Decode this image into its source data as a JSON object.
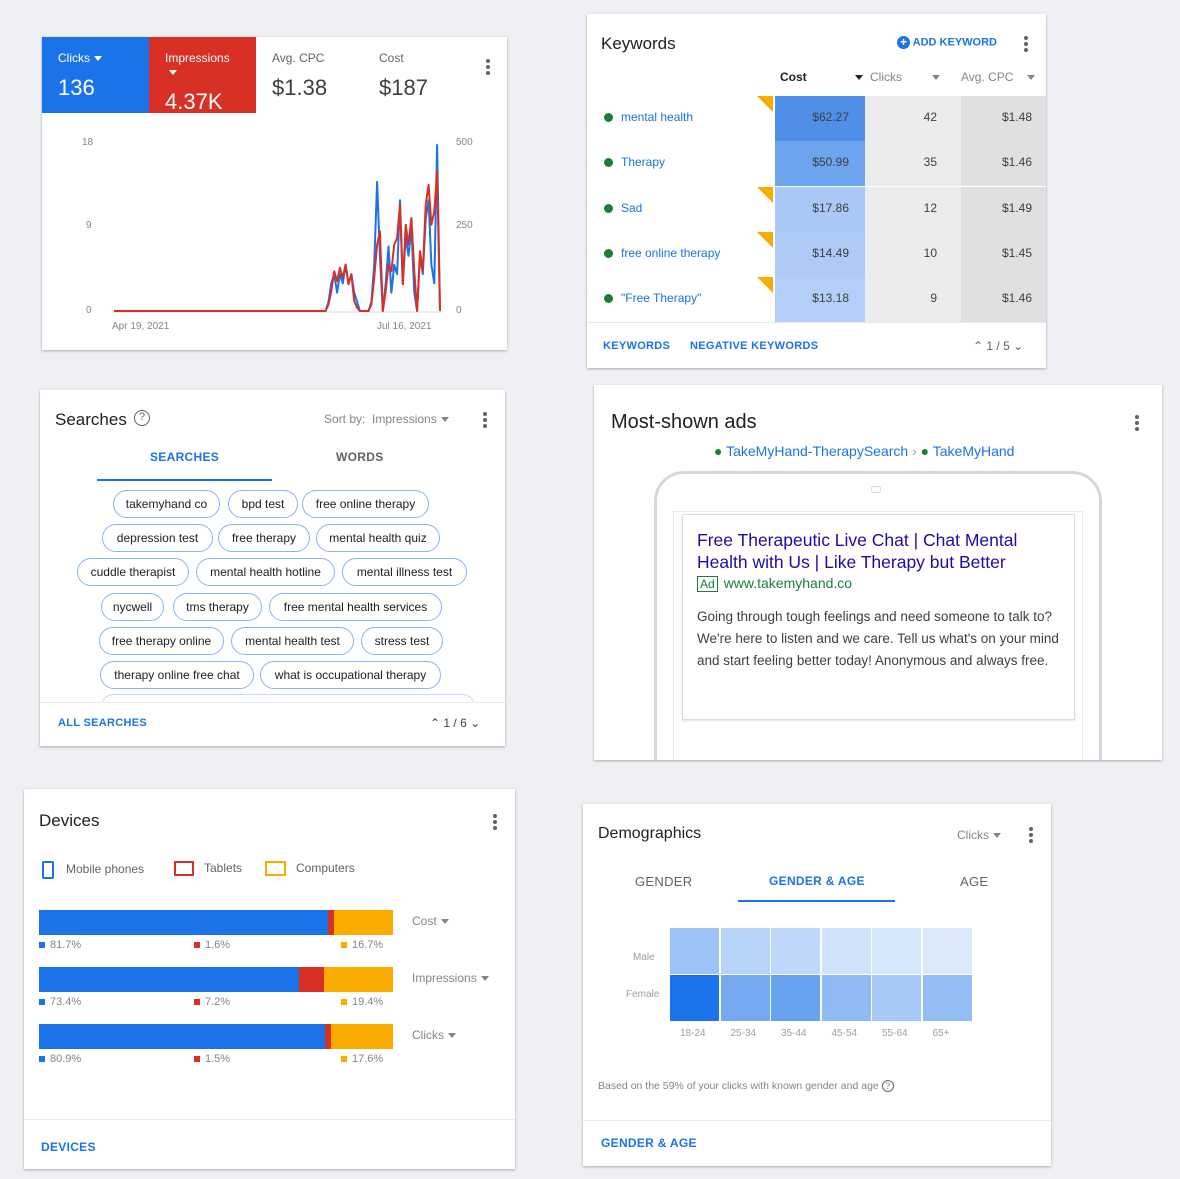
{
  "summary": {
    "metrics": [
      {
        "label": "Clicks",
        "value": "136"
      },
      {
        "label": "Impressions",
        "value": "4.37K"
      },
      {
        "label": "Avg. CPC",
        "value": "$1.38"
      },
      {
        "label": "Cost",
        "value": "$187"
      }
    ],
    "chart_data": {
      "type": "line",
      "x_start_label": "Apr 19, 2021",
      "x_end_label": "Jul 16, 2021",
      "y_left_ticks": [
        "18",
        "9",
        "0"
      ],
      "y_right_ticks": [
        "500",
        "250",
        "0"
      ],
      "ylim_left": [
        0,
        18
      ],
      "ylim_right": [
        0,
        500
      ],
      "series": [
        {
          "name": "Clicks",
          "color": "#1a73e8",
          "values": [
            0,
            0,
            0,
            0,
            0,
            0,
            0,
            0,
            0,
            0,
            0,
            0,
            0,
            0,
            0,
            0,
            0,
            0,
            0,
            0,
            0,
            0,
            0,
            0,
            0,
            0,
            0,
            0,
            0,
            0,
            0,
            0,
            0,
            0,
            0,
            0,
            0,
            0,
            0,
            0,
            0,
            0,
            0,
            0,
            0,
            0,
            0,
            0,
            0,
            0,
            0,
            0,
            0,
            0,
            0,
            0,
            0,
            0,
            0,
            0,
            0,
            0,
            0,
            0,
            0,
            0,
            0,
            0,
            0,
            0,
            0,
            0,
            0,
            0,
            0,
            1,
            3,
            4,
            2,
            4,
            3,
            5,
            3,
            4,
            2,
            1,
            0,
            0,
            0,
            0,
            1,
            5,
            14,
            6,
            0,
            3,
            7,
            2,
            5,
            4,
            12,
            3,
            8,
            6,
            9,
            2,
            0,
            6,
            4,
            10,
            12,
            5,
            3,
            18,
            0
          ]
        },
        {
          "name": "Impressions",
          "color": "#d93025",
          "values": [
            0,
            0,
            0,
            0,
            0,
            0,
            0,
            0,
            0,
            0,
            0,
            0,
            0,
            0,
            0,
            0,
            0,
            0,
            0,
            0,
            0,
            0,
            0,
            0,
            0,
            0,
            0,
            0,
            0,
            0,
            0,
            0,
            0,
            0,
            0,
            0,
            0,
            0,
            0,
            0,
            0,
            0,
            0,
            0,
            0,
            0,
            0,
            0,
            0,
            0,
            0,
            0,
            0,
            0,
            0,
            0,
            0,
            0,
            0,
            0,
            0,
            0,
            0,
            0,
            0,
            0,
            0,
            0,
            0,
            0,
            0,
            0,
            0,
            0,
            0,
            20,
            60,
            120,
            90,
            130,
            100,
            140,
            80,
            110,
            30,
            10,
            0,
            0,
            0,
            0,
            20,
            100,
            200,
            240,
            0,
            60,
            140,
            120,
            200,
            220,
            320,
            80,
            260,
            200,
            280,
            120,
            0,
            180,
            120,
            320,
            380,
            260,
            300,
            420,
            0
          ]
        }
      ]
    }
  },
  "keywords": {
    "title": "Keywords",
    "add_label": "ADD KEYWORD",
    "columns": [
      "Cost",
      "Clicks",
      "Avg. CPC"
    ],
    "rows": [
      {
        "name": "mental health",
        "cost": "$62.27",
        "clicks": "42",
        "cpc": "$1.48",
        "cost_fill": "#4f8fe8"
      },
      {
        "name": "Therapy",
        "cost": "$50.99",
        "clicks": "35",
        "cpc": "$1.46",
        "cost_fill": "#6ea3ee"
      },
      {
        "name": "Sad",
        "cost": "$17.86",
        "clicks": "12",
        "cpc": "$1.49",
        "cost_fill": "#a9c8f6"
      },
      {
        "name": "free online therapy",
        "cost": "$14.49",
        "clicks": "10",
        "cpc": "$1.45",
        "cost_fill": "#aecbf6"
      },
      {
        "name": "\"Free Therapy\"",
        "cost": "$13.18",
        "clicks": "9",
        "cpc": "$1.46",
        "cost_fill": "#b4cff7"
      }
    ],
    "footer_links": [
      "KEYWORDS",
      "NEGATIVE KEYWORDS"
    ],
    "pager": "1 / 5"
  },
  "searches": {
    "title": "Searches",
    "sort_label": "Sort by:",
    "sort_value": "Impressions",
    "tabs": [
      "SEARCHES",
      "WORDS"
    ],
    "chips": [
      "takemyhand co",
      "bpd test",
      "free online therapy",
      "depression test",
      "free therapy",
      "mental health quiz",
      "cuddle therapist",
      "mental health hotline",
      "mental illness test",
      "nycwell",
      "tms therapy",
      "free mental health services",
      "free therapy online",
      "mental health test",
      "stress test",
      "therapy online free chat",
      "what is occupational therapy"
    ],
    "footer_link": "ALL SEARCHES",
    "pager": "1 / 6"
  },
  "ads": {
    "title": "Most-shown ads",
    "breadcrumb": [
      "TakeMyHand-TherapySearch",
      "TakeMyHand"
    ],
    "headline": "Free Therapeutic Live Chat | Chat Mental Health with Us | Like Therapy but Better",
    "badge": "Ad",
    "url": "www.takemyhand.co",
    "description": "Going through tough feelings and need someone to talk to? We're here to listen and we care. Tell us what's on your mind and start feeling better today! Anonymous and always free."
  },
  "devices": {
    "title": "Devices",
    "legend": [
      "Mobile phones",
      "Tablets",
      "Computers"
    ],
    "colors": {
      "mobile": "#1a73e8",
      "tablet": "#d93025",
      "computer": "#f9ab00"
    },
    "rows": [
      {
        "metric": "Cost",
        "mobile": 81.7,
        "tablet": 1.6,
        "computer": 16.7,
        "mobile_t": "81.7%",
        "tablet_t": "1.6%",
        "computer_t": "16.7%"
      },
      {
        "metric": "Impressions",
        "mobile": 73.4,
        "tablet": 7.2,
        "computer": 19.4,
        "mobile_t": "73.4%",
        "tablet_t": "7.2%",
        "computer_t": "19.4%"
      },
      {
        "metric": "Clicks",
        "mobile": 80.9,
        "tablet": 1.5,
        "computer": 17.6,
        "mobile_t": "80.9%",
        "tablet_t": "1.5%",
        "computer_t": "17.6%"
      }
    ],
    "footer_link": "DEVICES"
  },
  "demographics": {
    "title": "Demographics",
    "metric": "Clicks",
    "tabs": [
      "GENDER",
      "GENDER & AGE",
      "AGE"
    ],
    "genders": [
      "Male",
      "Female"
    ],
    "ages": [
      "18-24",
      "25-34",
      "35-44",
      "45-54",
      "55-64",
      "65+"
    ],
    "heat": {
      "male": [
        0.35,
        0.22,
        0.18,
        0.1,
        0.06,
        0.04
      ],
      "female": [
        1.0,
        0.55,
        0.62,
        0.42,
        0.3,
        0.4
      ]
    },
    "note": "Based on the 59% of your clicks with known gender and age",
    "footer_link": "GENDER & AGE"
  }
}
